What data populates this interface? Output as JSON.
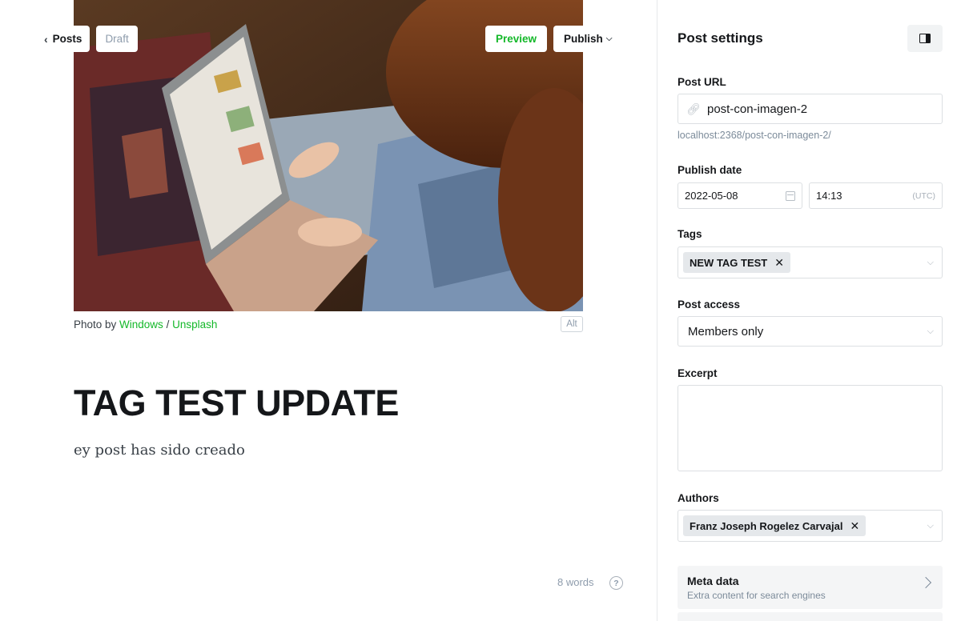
{
  "editor": {
    "nav": {
      "back_label": "Posts",
      "status": "Draft"
    },
    "actions": {
      "preview": "Preview",
      "publish": "Publish"
    },
    "feature_image": {
      "caption_prefix": "Photo by ",
      "author_link": "Windows",
      "separator": " / ",
      "source_link": "Unsplash",
      "alt_label": "Alt"
    },
    "title": "TAG TEST UPDATE",
    "body": "ey post has sido creado",
    "word_count": "8 words",
    "help_label": "?"
  },
  "settings": {
    "title": "Post settings",
    "url": {
      "label": "Post URL",
      "value": "post-con-imagen-2",
      "hint": "localhost:2368/post-con-imagen-2/"
    },
    "publish_date": {
      "label": "Publish date",
      "date": "2022-05-08",
      "time": "14:13",
      "tz": "(UTC)"
    },
    "tags": {
      "label": "Tags",
      "items": [
        "NEW TAG TEST"
      ]
    },
    "access": {
      "label": "Post access",
      "value": "Members only"
    },
    "excerpt": {
      "label": "Excerpt",
      "value": ""
    },
    "authors": {
      "label": "Authors",
      "items": [
        "Franz Joseph Rogelez Carvajal"
      ]
    },
    "meta": {
      "title": "Meta data",
      "subtitle": "Extra content for search engines"
    }
  },
  "colors": {
    "accent": "#14b829",
    "text": "#15171a",
    "muted": "#8e9cac",
    "border": "#dcdfe2"
  },
  "icons": [
    "chevron-left-icon",
    "chevron-down-icon",
    "link-icon",
    "calendar-icon",
    "close-icon",
    "help-icon",
    "sidebar-toggle-icon",
    "chevron-right-icon"
  ]
}
